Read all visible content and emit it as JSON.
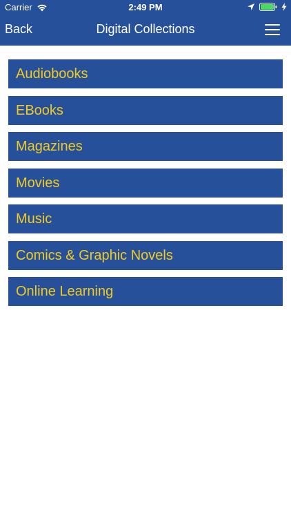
{
  "status_bar": {
    "carrier": "Carrier",
    "time": "2:49 PM",
    "icons": [
      "wifi-icon",
      "location-arrow-icon",
      "battery-icon",
      "charging-bolt-icon"
    ]
  },
  "nav": {
    "back_label": "Back",
    "title": "Digital Collections",
    "menu_icon": "hamburger-menu-icon"
  },
  "colors": {
    "bar_background": "#27509b",
    "item_background": "#27509b",
    "item_text": "#f2cb1d",
    "battery_fill": "#4cd964"
  },
  "collections": [
    {
      "label": "Audiobooks"
    },
    {
      "label": "EBooks"
    },
    {
      "label": "Magazines"
    },
    {
      "label": "Movies"
    },
    {
      "label": "Music"
    },
    {
      "label": "Comics & Graphic Novels"
    },
    {
      "label": "Online Learning"
    }
  ]
}
